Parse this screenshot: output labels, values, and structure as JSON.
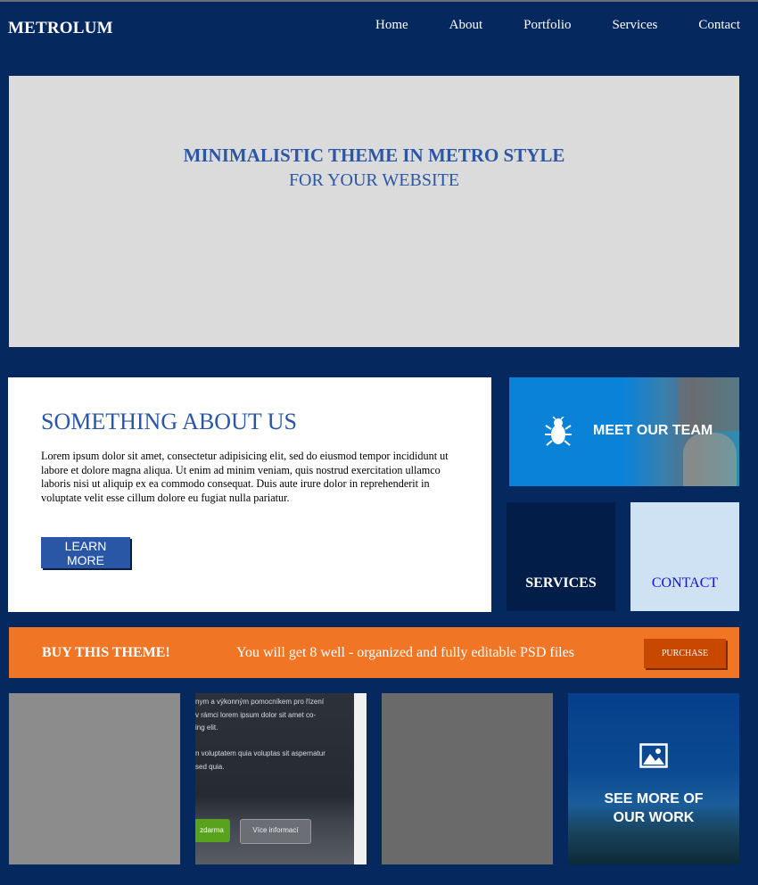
{
  "nav": {
    "brand": "METROLUM",
    "items": [
      {
        "label": "Home"
      },
      {
        "label": "About"
      },
      {
        "label": "Portfolio"
      },
      {
        "label": "Services"
      },
      {
        "label": "Contact"
      }
    ]
  },
  "hero": {
    "title": "MINIMALISTIC THEME IN METRO STYLE",
    "subtitle": "FOR YOUR WEBSITE"
  },
  "about": {
    "heading": "SOMETHING ABOUT US",
    "body": "Lorem ipsum dolor sit amet, consectetur adipisicing elit, sed do eiusmod tempor incididunt ut labore et dolore magna aliqua. Ut enim ad minim veniam, quis nostrud exercitation ullamco laboris nisi ut aliquip ex ea commodo consequat. Duis aute irure dolor in reprehenderit in voluptate velit esse cillum dolore eu fugiat nulla pariatur.",
    "button": "LEARN MORE"
  },
  "tiles": {
    "team": {
      "label": "MEET OUR TEAM",
      "icon": "bug-icon"
    },
    "services": {
      "label": "SERVICES"
    },
    "contact": {
      "label": "CONTACT"
    },
    "work": {
      "line1": "SEE MORE OF",
      "line2": "OUR WORK",
      "icon": "image-icon"
    }
  },
  "buybar": {
    "title": "BUY THIS THEME!",
    "text": "You will get 8 well - organized and fully editable PSD files",
    "button": "PURCHASE"
  },
  "portfolio_preview": {
    "lines": [
      "nym a výkonným pomocníkem pro řízení",
      "v rámci lorem ipsum dolor sit amet co-",
      "ing elit.",
      "",
      "n voluptatem quia voluptas sit aspernatur",
      "sed quia."
    ],
    "btn_green": "zdarma",
    "btn_grey": "Více informací"
  },
  "colors": {
    "background": "#05285f",
    "accent_blue": "#2a56a6",
    "orange": "#f07524",
    "purchase": "#c84800"
  }
}
